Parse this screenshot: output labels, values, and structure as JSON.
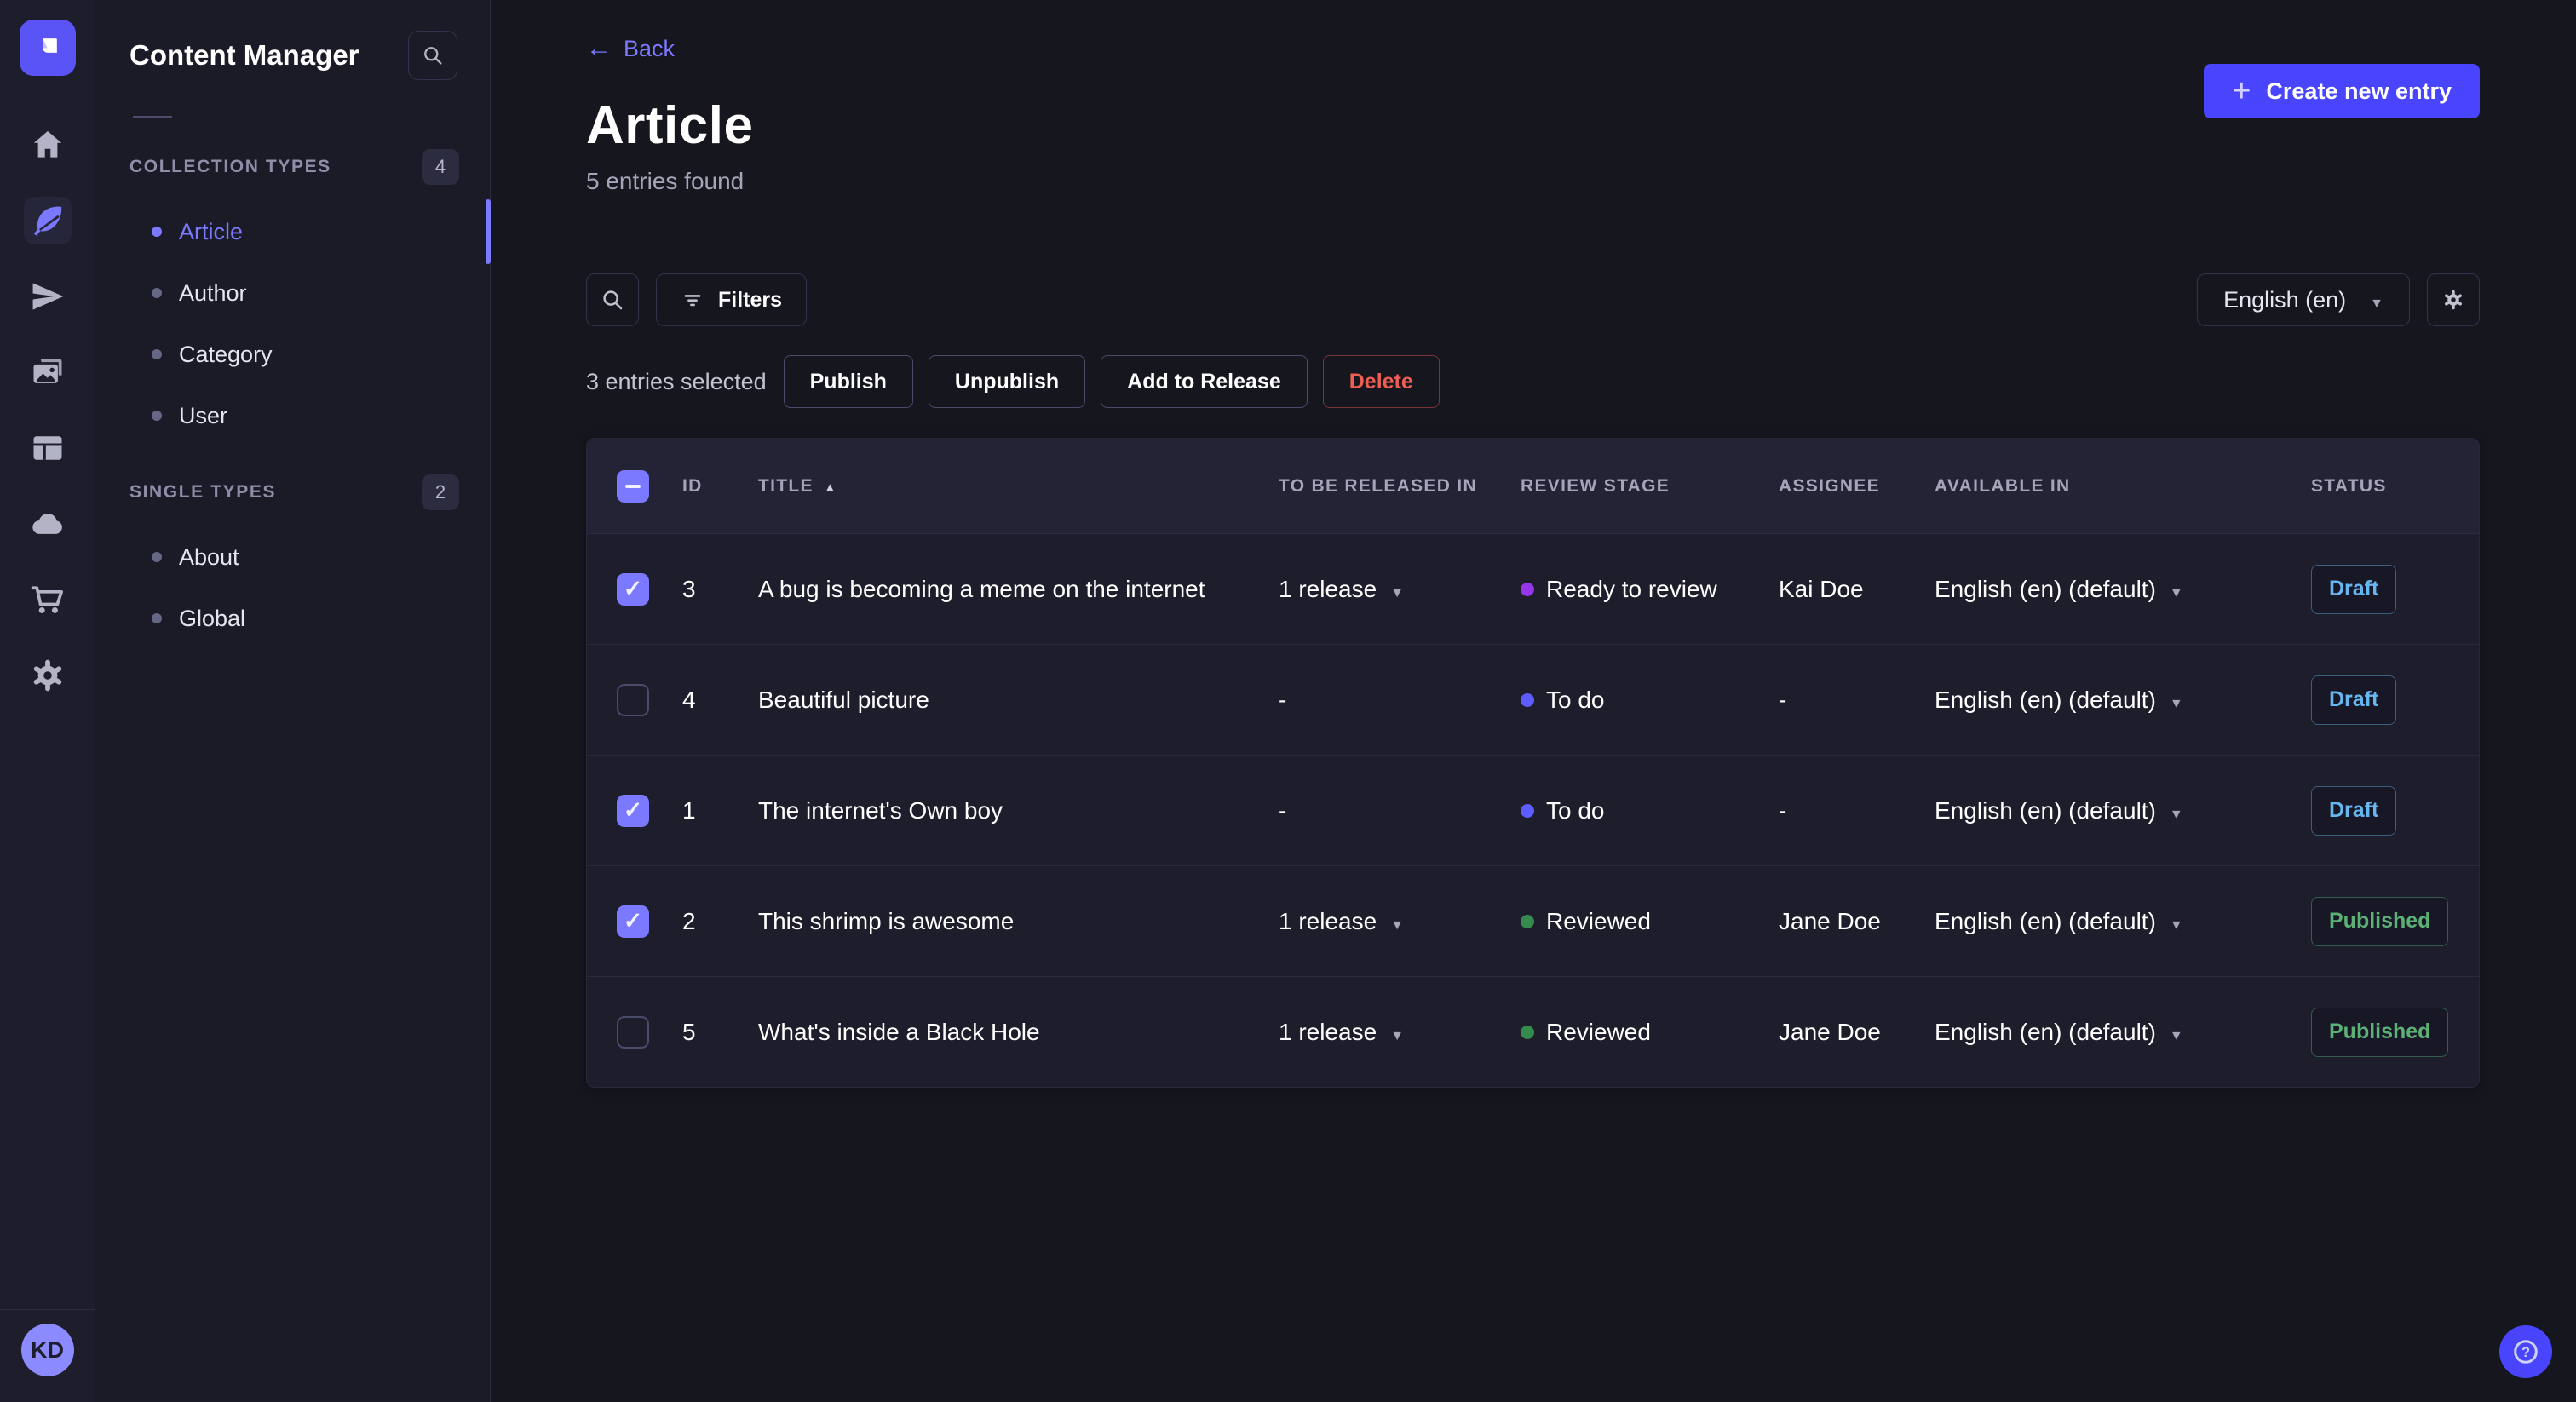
{
  "colors": {
    "accent": "#4945ff",
    "accent_light": "#7b79ff",
    "draft_status": "#66b7f1",
    "published_status": "#5cb176",
    "danger": "#ee5e52",
    "stage_ready_to_review": "#9736e8",
    "stage_to_do": "#5d5dff",
    "stage_reviewed": "#358a4d"
  },
  "rail": {
    "icons": [
      "home",
      "content-manager-feather",
      "releases-paper-plane",
      "media-library-pictures",
      "content-type-builder-layout",
      "deploy-cloud",
      "marketplace-cart",
      "settings-gear"
    ],
    "active_icon": "content-manager-feather"
  },
  "user": {
    "initials": "KD"
  },
  "subnav": {
    "title": "Content Manager",
    "sections": [
      {
        "label": "COLLECTION TYPES",
        "badge": "4",
        "items": [
          {
            "label": "Article",
            "active": true
          },
          {
            "label": "Author",
            "active": false
          },
          {
            "label": "Category",
            "active": false
          },
          {
            "label": "User",
            "active": false
          }
        ]
      },
      {
        "label": "SINGLE TYPES",
        "badge": "2",
        "items": [
          {
            "label": "About",
            "active": false
          },
          {
            "label": "Global",
            "active": false
          }
        ]
      }
    ]
  },
  "header": {
    "back_label": "Back",
    "title": "Article",
    "subtitle": "5 entries found",
    "create_button": "Create new entry"
  },
  "toolbar": {
    "filters_label": "Filters",
    "locale_selected": "English (en)"
  },
  "selection": {
    "summary": "3 entries selected",
    "actions": {
      "publish": "Publish",
      "unpublish": "Unpublish",
      "add_to_release": "Add to Release",
      "delete": "Delete"
    }
  },
  "table": {
    "select_all_state": "indeterminate",
    "sorted_column": "TITLE",
    "sort_direction": "asc",
    "columns": [
      "ID",
      "TITLE",
      "TO BE RELEASED IN",
      "REVIEW STAGE",
      "ASSIGNEE",
      "AVAILABLE IN",
      "STATUS"
    ],
    "rows": [
      {
        "checked": true,
        "id": "3",
        "title": "A bug is becoming a meme on the internet",
        "release": "1 release",
        "stage": "Ready to review",
        "stage_color": "#9736e8",
        "assignee": "Kai Doe",
        "locale": "English (en) (default)",
        "status": "Draft"
      },
      {
        "checked": false,
        "id": "4",
        "title": "Beautiful picture",
        "release": "-",
        "stage": "To do",
        "stage_color": "#5d5dff",
        "assignee": "-",
        "locale": "English (en) (default)",
        "status": "Draft"
      },
      {
        "checked": true,
        "id": "1",
        "title": "The internet's Own boy",
        "release": "-",
        "stage": "To do",
        "stage_color": "#5d5dff",
        "assignee": "-",
        "locale": "English (en) (default)",
        "status": "Draft"
      },
      {
        "checked": true,
        "id": "2",
        "title": "This shrimp is awesome",
        "release": "1 release",
        "stage": "Reviewed",
        "stage_color": "#358a4d",
        "assignee": "Jane Doe",
        "locale": "English (en) (default)",
        "status": "Published"
      },
      {
        "checked": false,
        "id": "5",
        "title": "What's inside a Black Hole",
        "release": "1 release",
        "stage": "Reviewed",
        "stage_color": "#358a4d",
        "assignee": "Jane Doe",
        "locale": "English (en) (default)",
        "status": "Published"
      }
    ]
  }
}
